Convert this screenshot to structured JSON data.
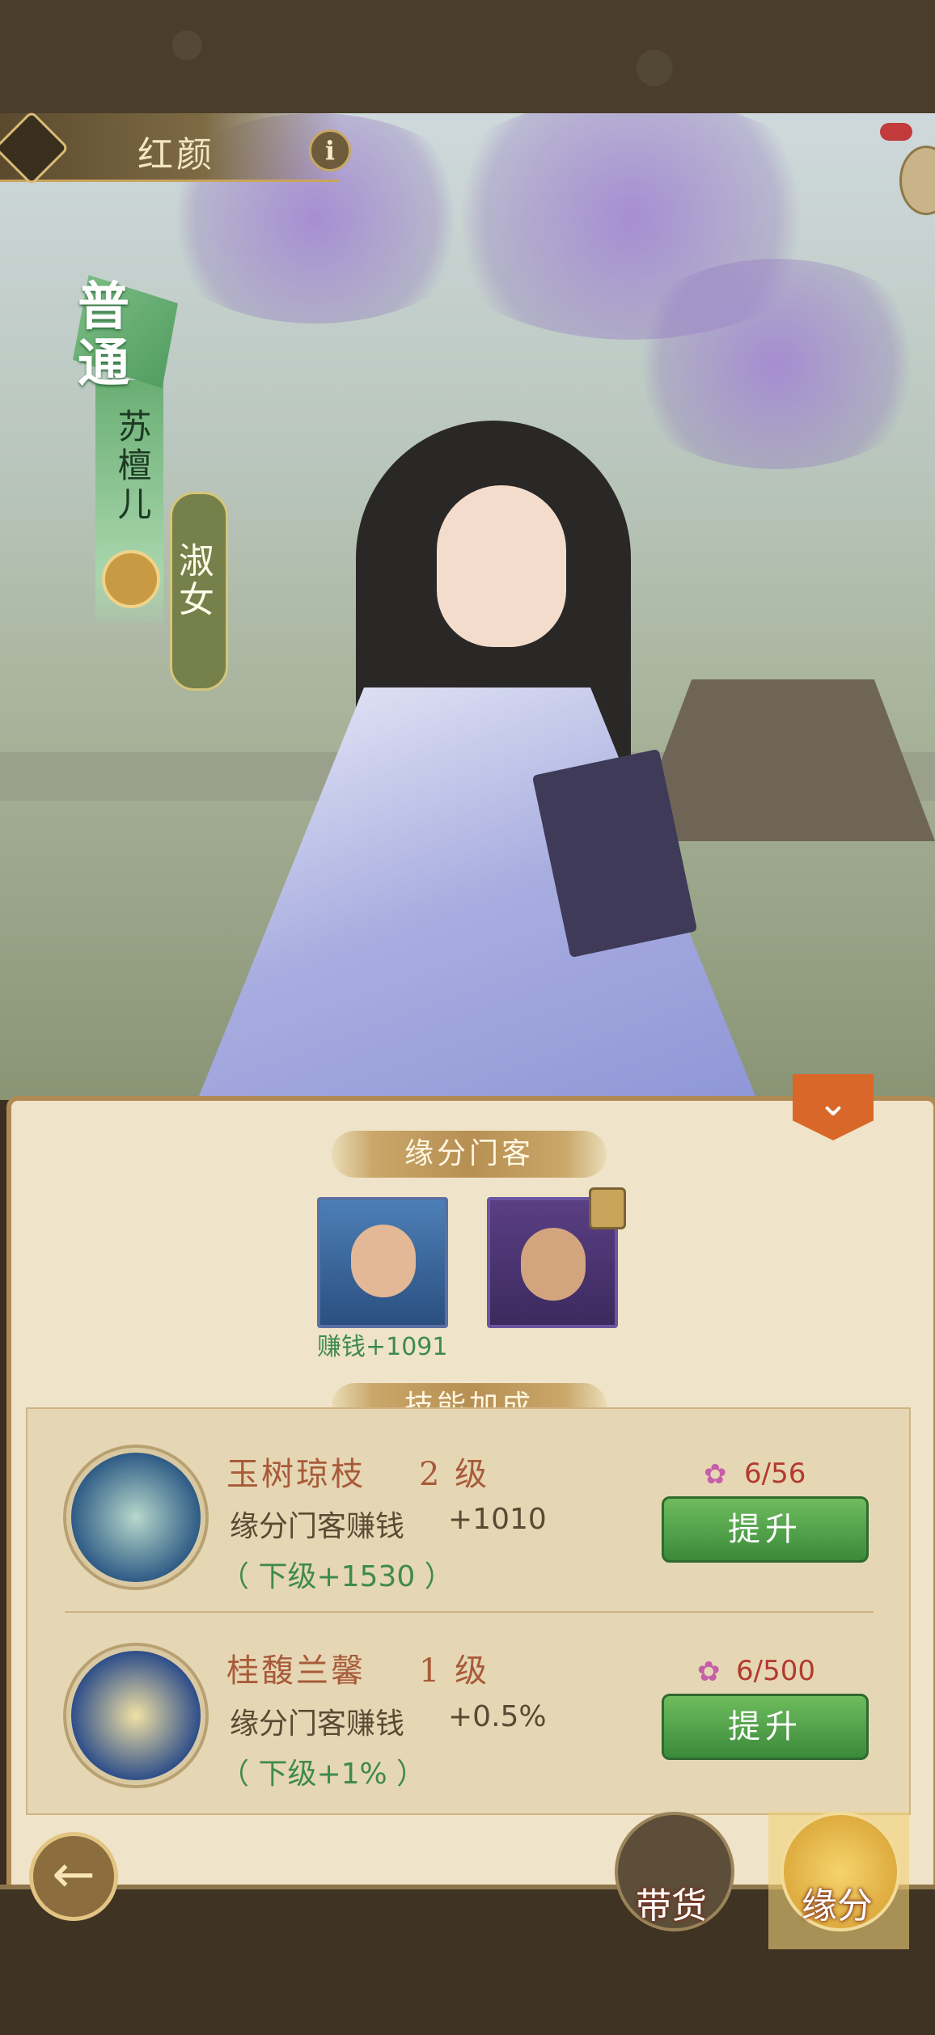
{
  "header": {
    "title": "红颜",
    "info_icon": "info-icon"
  },
  "character": {
    "rarity": "普通",
    "name": "苏檀儿",
    "trait": "淑女"
  },
  "fate_retainers": {
    "title": "缘分门客",
    "retainers": [
      {
        "earn_label": "赚钱+1091",
        "locked": false
      },
      {
        "earn_label": "",
        "locked": true
      }
    ]
  },
  "skills": {
    "title": "技能加成",
    "items": [
      {
        "name": "玉树琼枝",
        "level": "2 级",
        "desc": "缘分门客赚钱",
        "value": "+1010",
        "next": "（ 下级+1530 ）",
        "count": "6/56",
        "button": "提升"
      },
      {
        "name": "桂馥兰馨",
        "level": "1 级",
        "desc": "缘分门客赚钱",
        "value": "+0.5%",
        "next": "（ 下级+1% ）",
        "count": "6/500",
        "button": "提升"
      }
    ]
  },
  "nav": {
    "back_icon": "back-arrow-icon",
    "goods_label": "带货",
    "fate_label": "缘分"
  },
  "colors": {
    "accent_green": "#3b8a3b",
    "count_red": "#b23a2e",
    "panel_bg": "#efe4c9"
  }
}
